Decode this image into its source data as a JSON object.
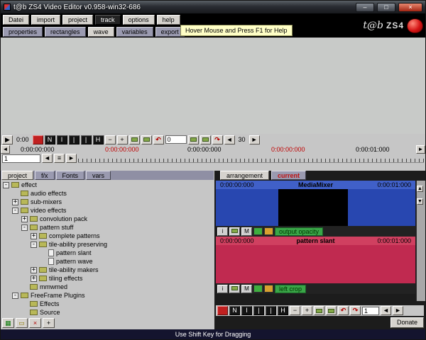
{
  "window": {
    "title": "t@b ZS4 Video Editor v0.958-win32-686",
    "controls": {
      "minimize": "–",
      "maximize": "□",
      "close": "×"
    }
  },
  "brand": {
    "script": "t@b",
    "zs4": "ZS4"
  },
  "menu": {
    "items": [
      "Datei",
      "import",
      "project",
      "track",
      "options",
      "help"
    ],
    "active": "track",
    "tooltip": "Hover Mouse and Press F1 for Help"
  },
  "panel_tabs": {
    "items": [
      "properties",
      "rectangles",
      "wave",
      "variables",
      "export"
    ],
    "selected": "wave"
  },
  "transport": {
    "play": "▶",
    "time": "0:00",
    "black_buttons": [
      "N",
      "I",
      "|",
      "|",
      "H"
    ],
    "zoom_out_label": "−",
    "zoom_in_label": "+",
    "undo_label": "↶",
    "redo_label": "↷",
    "frame_value": "0",
    "fps_value": "30",
    "prev_label": "◄",
    "next_label": "►"
  },
  "ruler": {
    "left_arrow": "◄",
    "right_arrow": "►",
    "marks": [
      {
        "text": "0:00:00:000",
        "color": "black"
      },
      {
        "text": "0:00:00:000",
        "color": "red"
      },
      {
        "text": "0:00:00:000",
        "color": "black"
      },
      {
        "text": "0:00:00:000",
        "color": "red"
      },
      {
        "text": "0:00:01:000",
        "color": "black"
      }
    ],
    "track_number": "1",
    "nav": [
      "◄",
      "≡",
      "►"
    ]
  },
  "left_panel": {
    "tabs": [
      "project",
      "f/x",
      "Fonts",
      "vars"
    ],
    "selected": "project",
    "tree": [
      {
        "label": "effect",
        "level": 0,
        "expander": "-",
        "icon": "folder"
      },
      {
        "label": "audio effects",
        "level": 1,
        "expander": "",
        "icon": "folder"
      },
      {
        "label": "sub-mixers",
        "level": 1,
        "expander": "+",
        "icon": "folder"
      },
      {
        "label": "video effects",
        "level": 1,
        "expander": "-",
        "icon": "folder"
      },
      {
        "label": "convolution pack",
        "level": 2,
        "expander": "+",
        "icon": "folder"
      },
      {
        "label": "pattern stuff",
        "level": 2,
        "expander": "-",
        "icon": "folder"
      },
      {
        "label": "complete patterns",
        "level": 3,
        "expander": "+",
        "icon": "folder"
      },
      {
        "label": "tile-ability preserving",
        "level": 3,
        "expander": "-",
        "icon": "folder"
      },
      {
        "label": "pattern slant",
        "level": 4,
        "expander": "",
        "icon": "page"
      },
      {
        "label": "pattern wave",
        "level": 4,
        "expander": "",
        "icon": "page"
      },
      {
        "label": "tile-ability makers",
        "level": 3,
        "expander": "+",
        "icon": "folder"
      },
      {
        "label": "tiling effects",
        "level": 3,
        "expander": "+",
        "icon": "folder"
      },
      {
        "label": "mmwmed",
        "level": 2,
        "expander": "",
        "icon": "folder"
      },
      {
        "label": "FreeFrame Plugins",
        "level": 1,
        "expander": "-",
        "icon": "folder"
      },
      {
        "label": "Effects",
        "level": 2,
        "expander": "",
        "icon": "folder"
      },
      {
        "label": "Source",
        "level": 2,
        "expander": "",
        "icon": "folder"
      }
    ],
    "footer_icons": [
      "▦",
      "▭",
      "×",
      "+"
    ]
  },
  "right_panel": {
    "tabs": {
      "arrangement": "arrangement",
      "current": "current"
    },
    "tracks": [
      {
        "start": "0:00:00:000",
        "name": "MediaMixer",
        "end": "0:00:01:000",
        "control_label": "output opacity"
      },
      {
        "start": "0:00:00:000",
        "name": "pattern slant",
        "end": "0:00:01:000",
        "control_label": "left crop"
      }
    ],
    "control_buttons": {
      "info": "i",
      "mixer": "M"
    },
    "scrollbar": {
      "up": "▲",
      "down": "▼"
    },
    "toolbar": {
      "black_buttons": [
        "N",
        "I",
        "|",
        "|",
        "H"
      ],
      "zoom_out_label": "−",
      "zoom_in_label": "+",
      "undo_label": "↶",
      "redo_label": "↷",
      "value": "1",
      "prev_label": "◄",
      "next_label": "►"
    },
    "donate_label": "Donate"
  },
  "statusbar": {
    "text": "Use Shift Key for Dragging"
  },
  "colors": {
    "track_blue_header": "#4060c8",
    "track_blue_body": "#2847b0",
    "track_red_header": "#d04060",
    "track_red_body": "#c02a50",
    "label_green": "#3aa648",
    "time_red": "#c00000"
  }
}
